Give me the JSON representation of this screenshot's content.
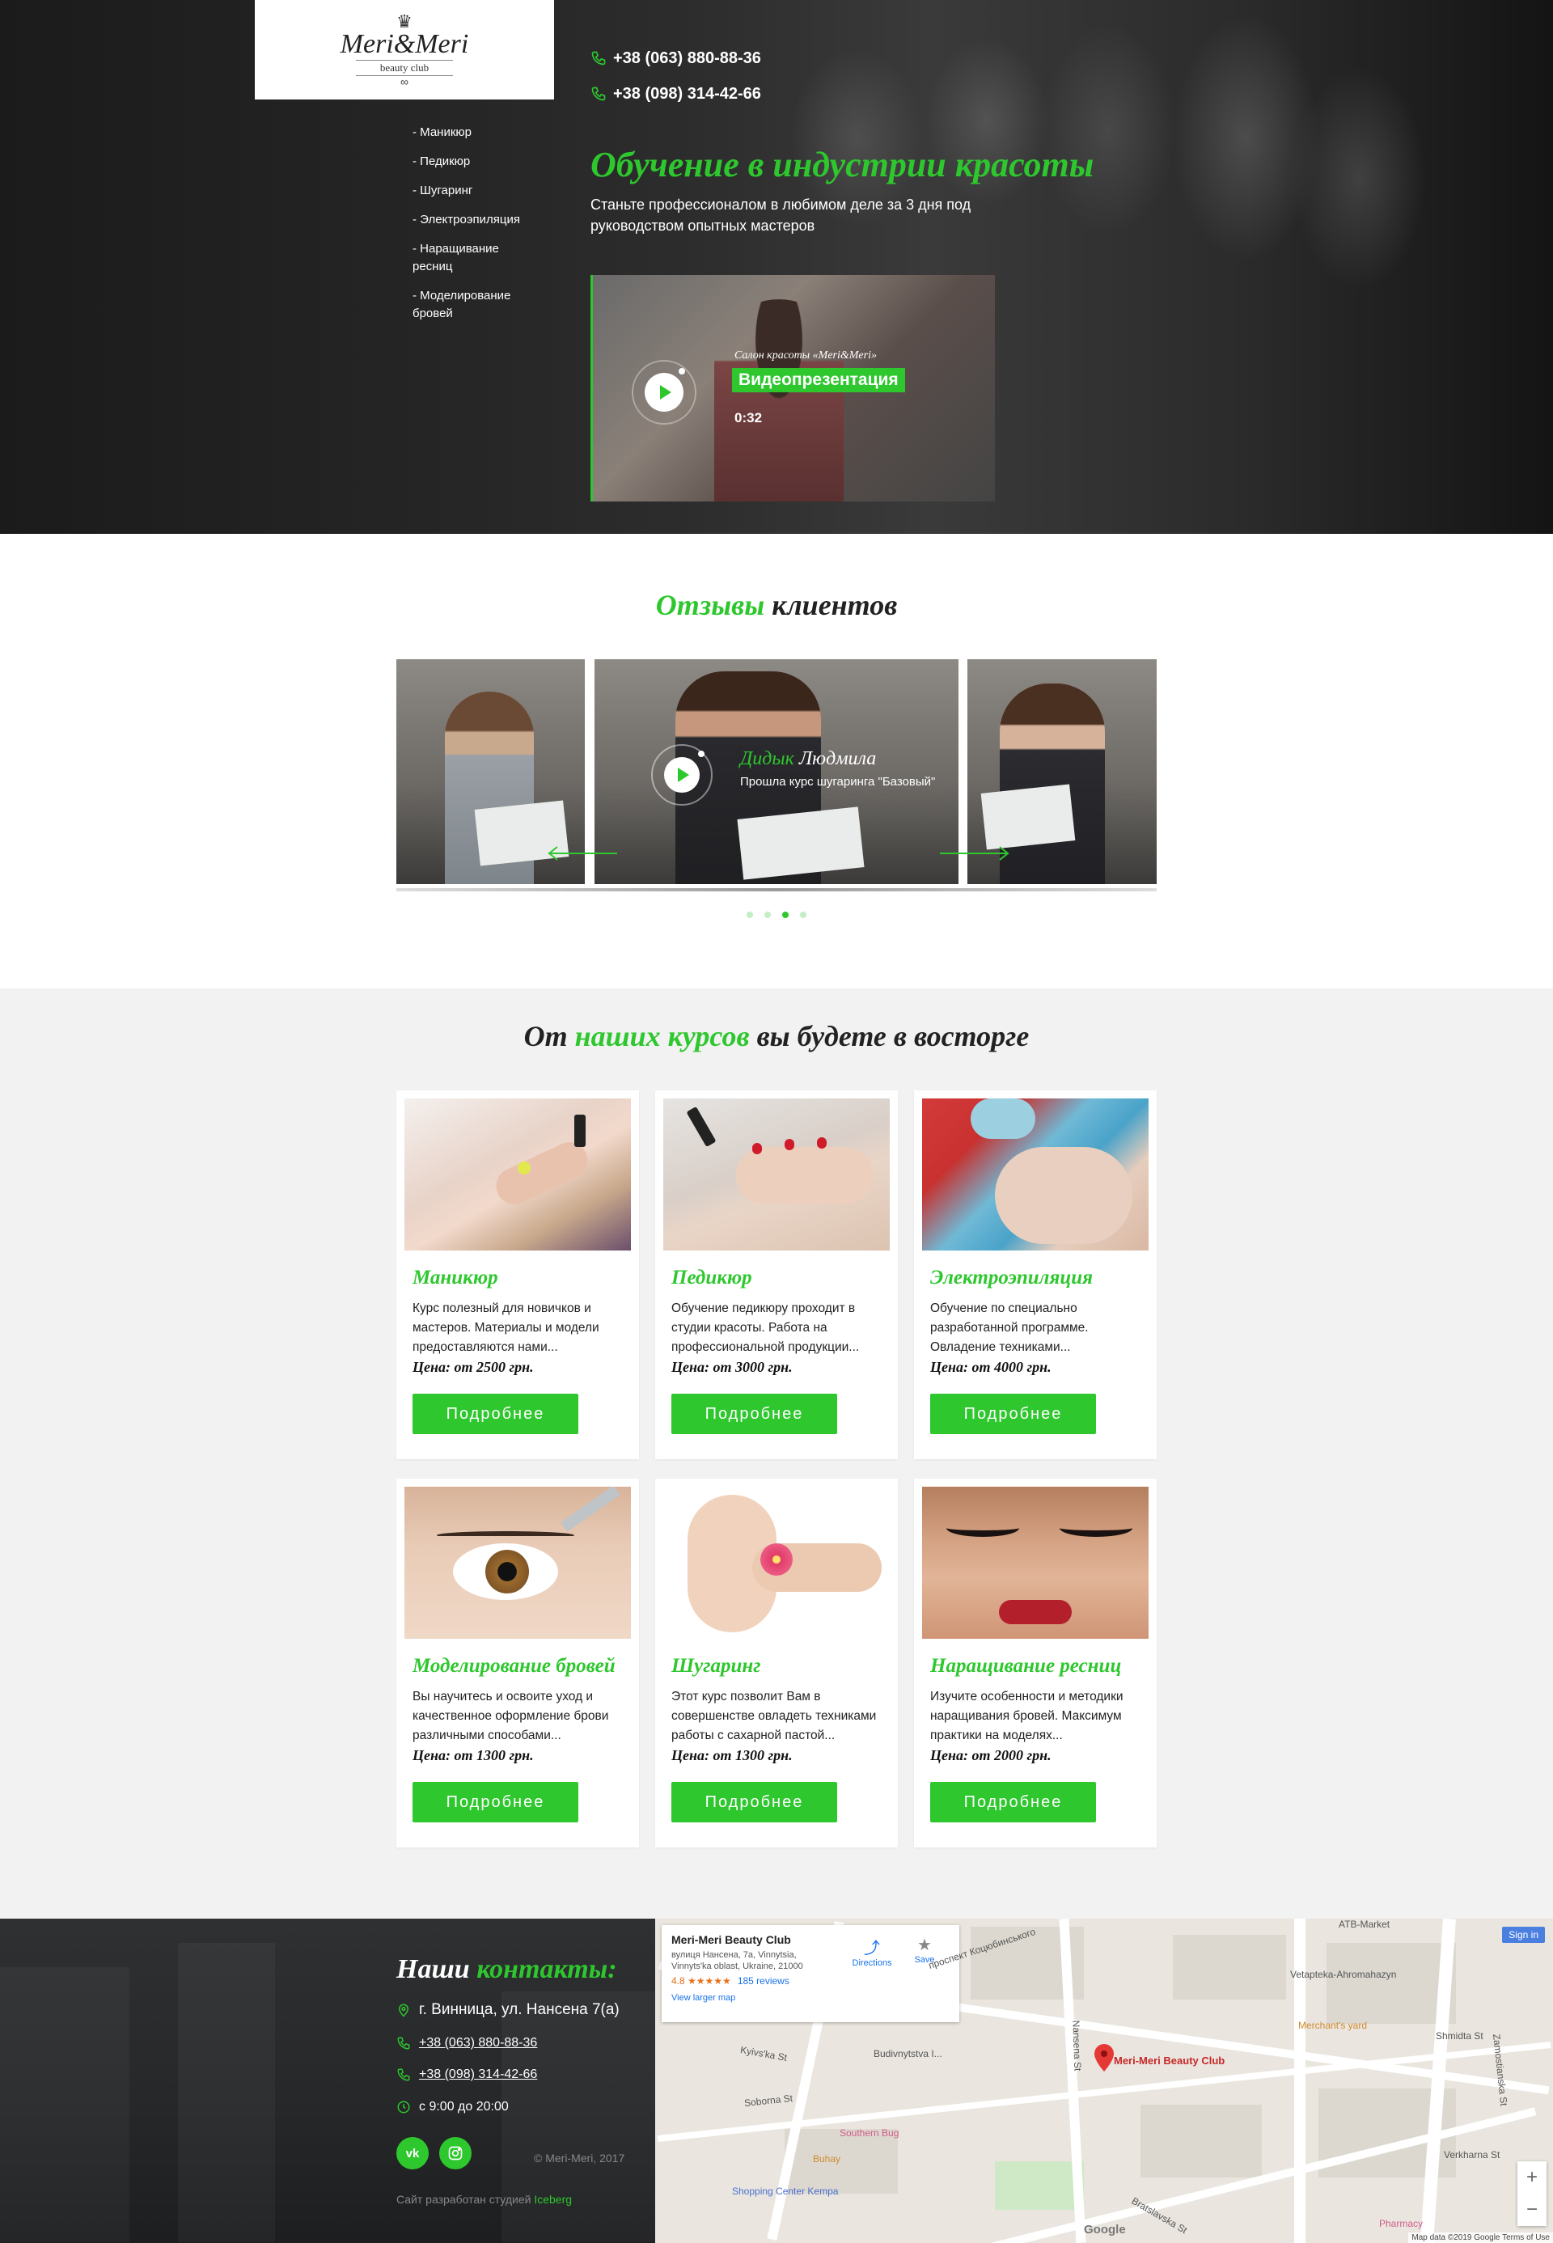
{
  "logo": {
    "main": "Meri&Meri",
    "sub": "beauty club"
  },
  "hero": {
    "menu": [
      "- Маникюр",
      "- Педикюр",
      "- Шугаринг",
      "- Электроэпиляция",
      "- Наращивание ресниц",
      "- Моделирование бровей"
    ],
    "phones": [
      "+38 (063) 880-88-36",
      "+38 (098) 314-42-66"
    ],
    "title": "Обучение в индустрии красоты",
    "subtitle": "Станьте профессионалом в любимом деле за 3 дня под руководством опытных мастеров",
    "video": {
      "caption": "Салон красоты «Meri&Meri»",
      "label": "Видеопрезентация",
      "duration": "0:32"
    }
  },
  "reviews": {
    "title_accent": "Отзывы",
    "title_rest": " клиентов",
    "current": {
      "first_name": "Дидык",
      "last_name": " Людмила",
      "course": "Прошла курс шугаринга \"Базовый\""
    },
    "dots": 4,
    "active_dot": 2
  },
  "courses": {
    "title_start": "От ",
    "title_accent": "наших курсов",
    "title_end": " вы будете в восторге",
    "button_label": "Подробнее",
    "items": [
      {
        "title": "Маникюр",
        "text": "Курс полезный для новичков и мастеров. Материалы и модели предоставляются нами...",
        "price": "Цена: от 2500 грн."
      },
      {
        "title": "Педикюр",
        "text": "Обучение педикюру проходит в студии красоты. Работа на профессиональной продукции...",
        "price": "Цена: от 3000 грн."
      },
      {
        "title": "Электроэпиляция",
        "text": "Обучение по специально разработанной программе. Овладение техниками...",
        "price": "Цена: от 4000 грн."
      },
      {
        "title": "Моделирование бровей",
        "text": "Вы научитесь и освоите уход и качественное оформление брови различными способами...",
        "price": "Цена: от 1300 грн."
      },
      {
        "title": "Шугаринг",
        "text": "Этот курс позволит Вам в совершенстве овладеть техниками работы с сахарной пастой...",
        "price": "Цена: от 1300 грн."
      },
      {
        "title": "Наращивание ресниц",
        "text": "Изучите особенности и методики наращивания бровей. Максимум практики на моделях...",
        "price": "Цена: от 2000 грн."
      }
    ]
  },
  "footer": {
    "title_start": "Наши ",
    "title_accent": "контакты:",
    "address": "г. Винница, ул. Нансена 7(а)",
    "phones": [
      "+38 (063) 880-88-36",
      "+38 (098) 314-42-66"
    ],
    "hours": "с 9:00 до 20:00",
    "social": [
      "vk-icon",
      "instagram-icon"
    ],
    "copyright": "© Meri-Meri, 2017",
    "dev_text": "Сайт разработан студией ",
    "dev_link": "Iceberg"
  },
  "map": {
    "place": "Meri-Meri Beauty Club",
    "address": "вулиця Нансена, 7а, Vinnytsia, Vinnyts'ka oblast, Ukraine, 21000",
    "rating": "4.8 ★★★★★",
    "reviews": "185 reviews",
    "view_larger": "View larger map",
    "directions": "Directions",
    "save": "Save",
    "sign_in": "Sign in",
    "pin_label": "Meri-Meri Beauty Club",
    "streets": [
      "Kyivs'ka St",
      "Soborna St",
      "Budivnytstva I...",
      "Southern Bug",
      "Buhay",
      "Shopping Center Kempa",
      "Vetapteka-Ahromahazyn",
      "Merchant's yard",
      "Pharmacy",
      "ATB-Market",
      "Zamostianska St",
      "Verkharna St",
      "Shmidta St",
      "Bratslavska St",
      "проспект Коцюбинського",
      "Nansena St"
    ],
    "credit": "Map data ©2019 Google   Terms of Use",
    "google": "Google"
  }
}
